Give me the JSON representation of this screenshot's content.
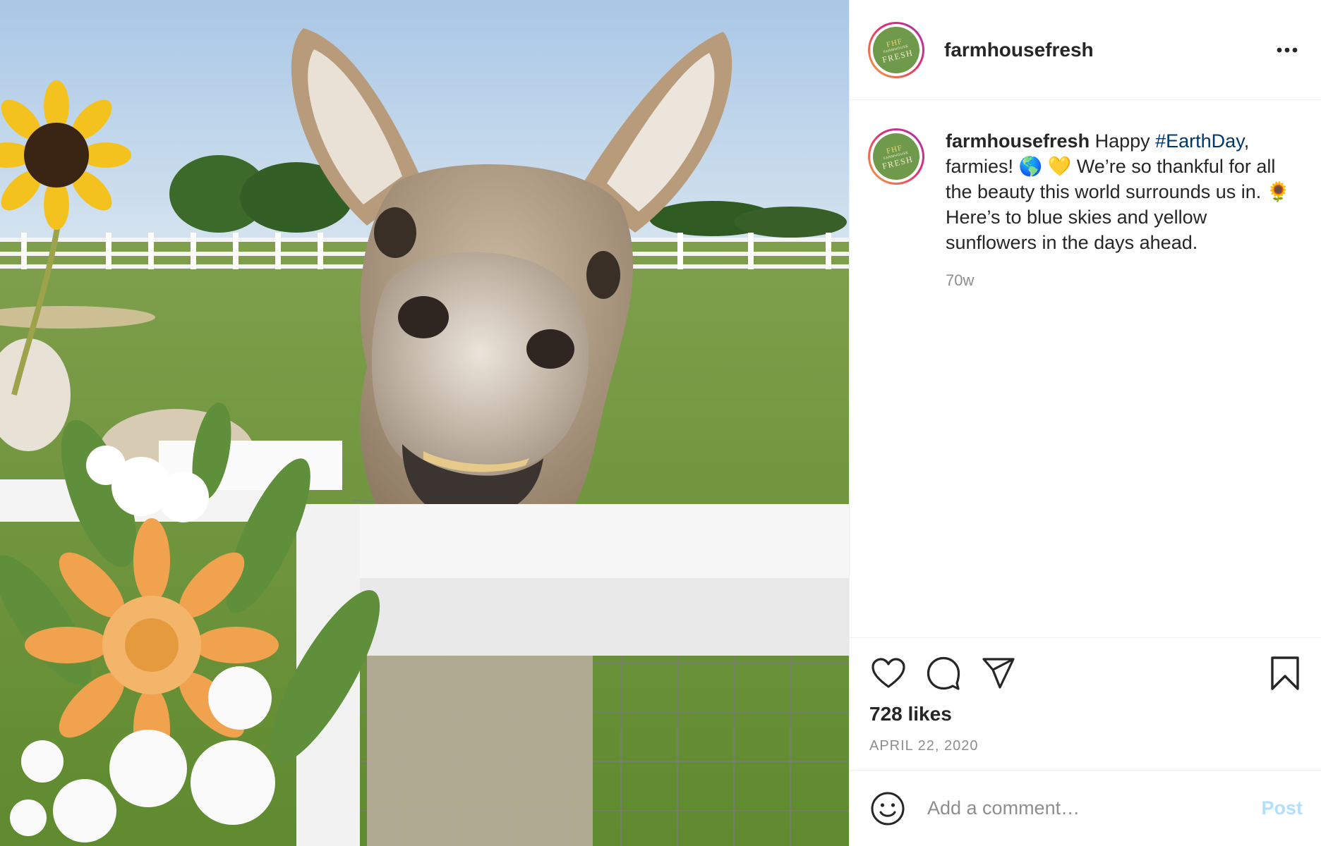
{
  "post": {
    "author": "farmhousefresh",
    "avatar_text": [
      "FHF",
      "FARMHOUSE",
      "FRESH"
    ],
    "photo_alt": "Donkey smiling over a white fence with a sunflower and bouquet",
    "caption": {
      "username": "farmhousefresh",
      "text_before_hashtag": " Happy ",
      "hashtag": "#EarthDay",
      "text_after_hashtag": ", farmies! 🌎 💛 We’re so thankful for all the beauty this world surrounds us in. 🌻 Here’s to blue skies and yellow sunflowers in the days ahead."
    },
    "time_ago": "70w",
    "likes": "728 likes",
    "date": "APRIL 22, 2020"
  },
  "icons": {
    "more": "more-options-icon",
    "like": "heart-icon",
    "comment": "comment-icon",
    "share": "send-icon",
    "save": "bookmark-icon",
    "emoji": "emoji-icon"
  },
  "comment_box": {
    "placeholder": "Add a comment…",
    "post_label": "Post"
  },
  "colors": {
    "hashtag": "#00376b",
    "post_button_disabled": "#b2dffc",
    "secondary_text": "#8e8e8e",
    "avatar_bg": "#6f9a4c"
  }
}
